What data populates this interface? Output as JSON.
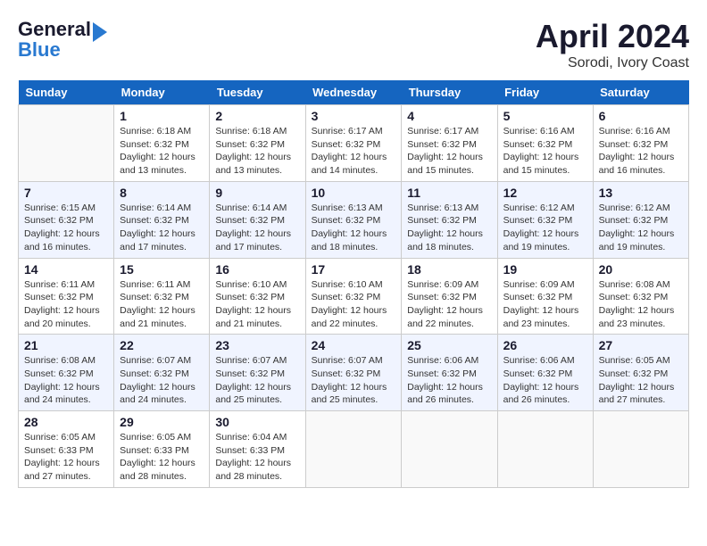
{
  "header": {
    "logo_general": "General",
    "logo_blue": "Blue",
    "month": "April 2024",
    "location": "Sorodi, Ivory Coast"
  },
  "days_of_week": [
    "Sunday",
    "Monday",
    "Tuesday",
    "Wednesday",
    "Thursday",
    "Friday",
    "Saturday"
  ],
  "weeks": [
    [
      {
        "day": "",
        "info": ""
      },
      {
        "day": "1",
        "info": "Sunrise: 6:18 AM\nSunset: 6:32 PM\nDaylight: 12 hours\nand 13 minutes."
      },
      {
        "day": "2",
        "info": "Sunrise: 6:18 AM\nSunset: 6:32 PM\nDaylight: 12 hours\nand 13 minutes."
      },
      {
        "day": "3",
        "info": "Sunrise: 6:17 AM\nSunset: 6:32 PM\nDaylight: 12 hours\nand 14 minutes."
      },
      {
        "day": "4",
        "info": "Sunrise: 6:17 AM\nSunset: 6:32 PM\nDaylight: 12 hours\nand 15 minutes."
      },
      {
        "day": "5",
        "info": "Sunrise: 6:16 AM\nSunset: 6:32 PM\nDaylight: 12 hours\nand 15 minutes."
      },
      {
        "day": "6",
        "info": "Sunrise: 6:16 AM\nSunset: 6:32 PM\nDaylight: 12 hours\nand 16 minutes."
      }
    ],
    [
      {
        "day": "7",
        "info": "Sunrise: 6:15 AM\nSunset: 6:32 PM\nDaylight: 12 hours\nand 16 minutes."
      },
      {
        "day": "8",
        "info": "Sunrise: 6:14 AM\nSunset: 6:32 PM\nDaylight: 12 hours\nand 17 minutes."
      },
      {
        "day": "9",
        "info": "Sunrise: 6:14 AM\nSunset: 6:32 PM\nDaylight: 12 hours\nand 17 minutes."
      },
      {
        "day": "10",
        "info": "Sunrise: 6:13 AM\nSunset: 6:32 PM\nDaylight: 12 hours\nand 18 minutes."
      },
      {
        "day": "11",
        "info": "Sunrise: 6:13 AM\nSunset: 6:32 PM\nDaylight: 12 hours\nand 18 minutes."
      },
      {
        "day": "12",
        "info": "Sunrise: 6:12 AM\nSunset: 6:32 PM\nDaylight: 12 hours\nand 19 minutes."
      },
      {
        "day": "13",
        "info": "Sunrise: 6:12 AM\nSunset: 6:32 PM\nDaylight: 12 hours\nand 19 minutes."
      }
    ],
    [
      {
        "day": "14",
        "info": "Sunrise: 6:11 AM\nSunset: 6:32 PM\nDaylight: 12 hours\nand 20 minutes."
      },
      {
        "day": "15",
        "info": "Sunrise: 6:11 AM\nSunset: 6:32 PM\nDaylight: 12 hours\nand 21 minutes."
      },
      {
        "day": "16",
        "info": "Sunrise: 6:10 AM\nSunset: 6:32 PM\nDaylight: 12 hours\nand 21 minutes."
      },
      {
        "day": "17",
        "info": "Sunrise: 6:10 AM\nSunset: 6:32 PM\nDaylight: 12 hours\nand 22 minutes."
      },
      {
        "day": "18",
        "info": "Sunrise: 6:09 AM\nSunset: 6:32 PM\nDaylight: 12 hours\nand 22 minutes."
      },
      {
        "day": "19",
        "info": "Sunrise: 6:09 AM\nSunset: 6:32 PM\nDaylight: 12 hours\nand 23 minutes."
      },
      {
        "day": "20",
        "info": "Sunrise: 6:08 AM\nSunset: 6:32 PM\nDaylight: 12 hours\nand 23 minutes."
      }
    ],
    [
      {
        "day": "21",
        "info": "Sunrise: 6:08 AM\nSunset: 6:32 PM\nDaylight: 12 hours\nand 24 minutes."
      },
      {
        "day": "22",
        "info": "Sunrise: 6:07 AM\nSunset: 6:32 PM\nDaylight: 12 hours\nand 24 minutes."
      },
      {
        "day": "23",
        "info": "Sunrise: 6:07 AM\nSunset: 6:32 PM\nDaylight: 12 hours\nand 25 minutes."
      },
      {
        "day": "24",
        "info": "Sunrise: 6:07 AM\nSunset: 6:32 PM\nDaylight: 12 hours\nand 25 minutes."
      },
      {
        "day": "25",
        "info": "Sunrise: 6:06 AM\nSunset: 6:32 PM\nDaylight: 12 hours\nand 26 minutes."
      },
      {
        "day": "26",
        "info": "Sunrise: 6:06 AM\nSunset: 6:32 PM\nDaylight: 12 hours\nand 26 minutes."
      },
      {
        "day": "27",
        "info": "Sunrise: 6:05 AM\nSunset: 6:32 PM\nDaylight: 12 hours\nand 27 minutes."
      }
    ],
    [
      {
        "day": "28",
        "info": "Sunrise: 6:05 AM\nSunset: 6:33 PM\nDaylight: 12 hours\nand 27 minutes."
      },
      {
        "day": "29",
        "info": "Sunrise: 6:05 AM\nSunset: 6:33 PM\nDaylight: 12 hours\nand 28 minutes."
      },
      {
        "day": "30",
        "info": "Sunrise: 6:04 AM\nSunset: 6:33 PM\nDaylight: 12 hours\nand 28 minutes."
      },
      {
        "day": "",
        "info": ""
      },
      {
        "day": "",
        "info": ""
      },
      {
        "day": "",
        "info": ""
      },
      {
        "day": "",
        "info": ""
      }
    ]
  ]
}
